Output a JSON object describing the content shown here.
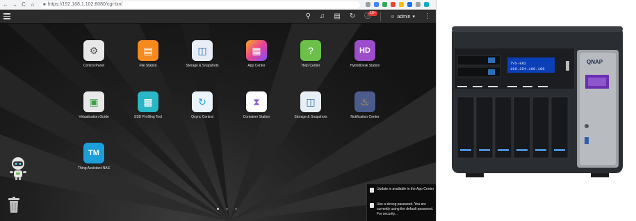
{
  "browser": {
    "address": "https://192.168.1.102:8080/cgi-bin/",
    "nav": [
      "←",
      "→",
      "C",
      "⌂"
    ]
  },
  "topbar": {
    "notification_count": "10+",
    "username": "admin"
  },
  "apps": [
    {
      "label": "Control Panel",
      "icon": "gear-icon",
      "color": "#e8e8e8"
    },
    {
      "label": "File Station",
      "icon": "folder-icon",
      "color": "#f58a1f"
    },
    {
      "label": "Storage & Snapshots",
      "icon": "storage-icon",
      "color": "#e8eef5"
    },
    {
      "label": "App Center",
      "icon": "grid-icon",
      "color": "#e84393"
    },
    {
      "label": "Help Center",
      "icon": "question-icon",
      "color": "#6cc04a"
    },
    {
      "label": "HybridDesk Station",
      "icon": "hd-icon",
      "color": "#9b4dca"
    },
    {
      "label": "Virtualization Guide",
      "icon": "cube-icon",
      "color": "#e8e8e8"
    },
    {
      "label": "SSD Profiling Tool",
      "icon": "ssd-icon",
      "color": "#29b6c6"
    },
    {
      "label": "Qsync Central",
      "icon": "sync-icon",
      "color": "#eaf4fb"
    },
    {
      "label": "Container Station",
      "icon": "container-icon",
      "color": "#ffffff"
    },
    {
      "label": "Storage & Snapshots",
      "icon": "storage-icon",
      "color": "#e8eef5"
    },
    {
      "label": "Notification Center",
      "icon": "bell-icon",
      "color": "#4a5b8c"
    },
    {
      "label": "Thing Assistant-NAS",
      "icon": "tm-icon",
      "color": "#1c9fd8"
    }
  ],
  "notifications": [
    "Update is available in the App Center",
    "Use a strong password. You are currently using the default password. For security..."
  ],
  "photo": {
    "brand": "QNAP",
    "model": "TVS-882",
    "ip": "169.254.100.100"
  }
}
